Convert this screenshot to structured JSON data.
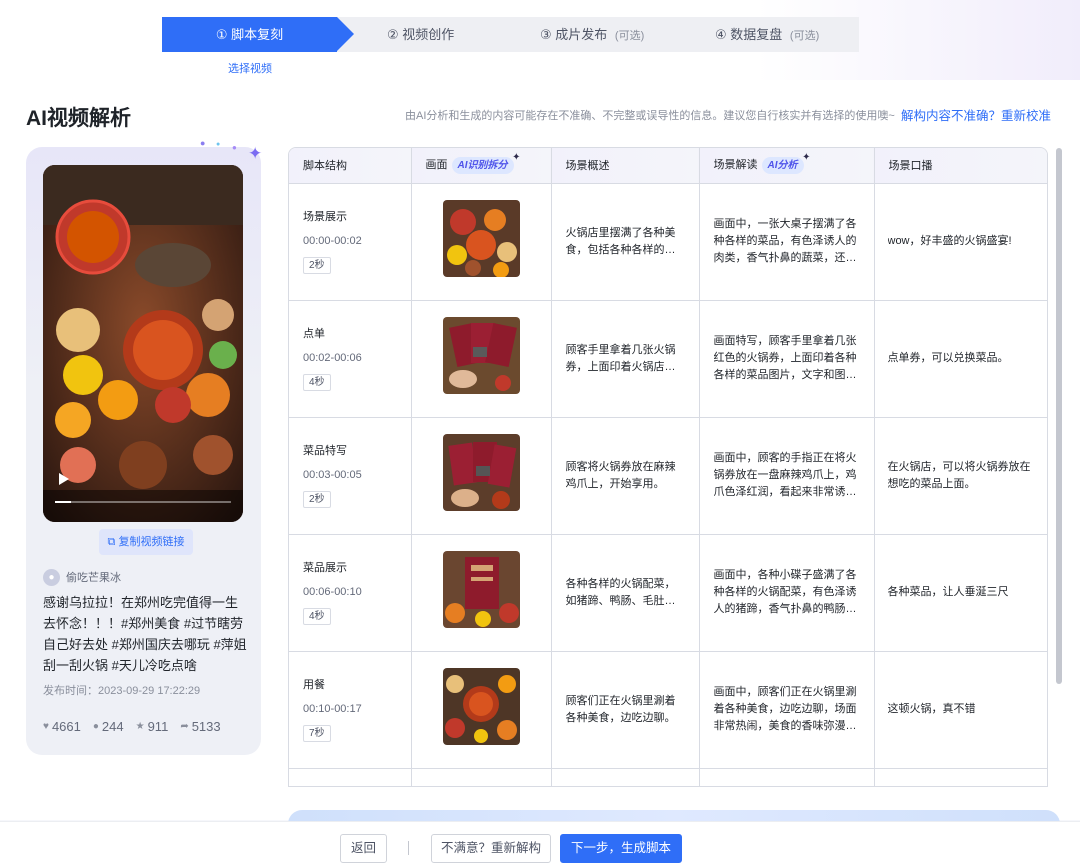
{
  "stepper": {
    "steps": [
      {
        "num": "①",
        "label": "脚本复刻",
        "optional": ""
      },
      {
        "num": "②",
        "label": "视频创作",
        "optional": ""
      },
      {
        "num": "③",
        "label": "成片发布",
        "optional": "(可选)"
      },
      {
        "num": "④",
        "label": "数据复盘",
        "optional": "(可选)"
      }
    ],
    "active_sub": "选择视频"
  },
  "header": {
    "title": "AI视频解析",
    "disclaimer": "由AI分析和生成的内容可能存在不准确、不完整或误导性的信息。建议您自行核实并有选择的使用噢~",
    "recalibrate_link": "解构内容不准确？重新校准"
  },
  "video_card": {
    "copy_link_label": "复制视频链接",
    "author": "偷吃芒果冰",
    "description": "感谢乌拉拉！在郑州吃完值得一生去怀念！！！#郑州美食 #过节瞎劳自己好去处 #郑州国庆去哪玩 #萍姐刮一刮火锅 #天儿冷吃点啥",
    "publish_time": "发布时间：2023-09-29 17:22:29",
    "stats": {
      "likes": "4661",
      "comments": "244",
      "favorites": "911",
      "shares": "5133"
    }
  },
  "table": {
    "headers": {
      "structure": "脚本结构",
      "frame": "画面",
      "frame_tag": "AI识别拆分",
      "summary": "场景概述",
      "interpretation": "场景解读",
      "interpretation_tag": "AI分析",
      "voiceover": "场景口播"
    },
    "rows": [
      {
        "name": "场景展示",
        "time": "00:00-00:02",
        "duration": "2秒",
        "summary": "火锅店里摆满了各种美食，包括各种各样的菜品和火锅。",
        "interpretation": "画面中，一张大桌子摆满了各种各样的菜品，有色泽诱人的肉类，香气扑鼻的蔬菜，还有热气腾腾的火锅。",
        "voiceover": "wow，好丰盛的火锅盛宴!"
      },
      {
        "name": "点单",
        "time": "00:02-00:06",
        "duration": "4秒",
        "summary": "顾客手里拿着几张火锅券，上面印着火锅店的名字和优惠。",
        "interpretation": "画面特写，顾客手里拿着几张红色的火锅券，上面印着各种各样的菜品图片，文字和图案清晰可见。",
        "voiceover": "点单券，可以兑换菜品。"
      },
      {
        "name": "菜品特写",
        "time": "00:03-00:05",
        "duration": "2秒",
        "summary": "顾客将火锅券放在麻辣鸡爪上，开始享用。",
        "interpretation": "画面中，顾客的手指正在将火锅券放在一盘麻辣鸡爪上，鸡爪色泽红润，看起来非常诱人可口。",
        "voiceover": "在火锅店，可以将火锅券放在想吃的菜品上面。"
      },
      {
        "name": "菜品展示",
        "time": "00:06-00:10",
        "duration": "4秒",
        "summary": "各种各样的火锅配菜，如猪蹄、鸭肠、毛肚等等。",
        "interpretation": "画面中，各种小碟子盛满了各种各样的火锅配菜，有色泽诱人的猪蹄，香气扑鼻的鸭肠，还有毛肚。",
        "voiceover": "各种菜品，让人垂涎三尺"
      },
      {
        "name": "用餐",
        "time": "00:10-00:17",
        "duration": "7秒",
        "summary": "顾客们正在火锅里涮着各种美食，边吃边聊。",
        "interpretation": "画面中，顾客们正在火锅里涮着各种美食，边吃边聊，场面非常热闹，美食的香味弥漫在空气中。",
        "voiceover": "这顿火锅，真不错"
      }
    ]
  },
  "footer": {
    "back_label": "返回",
    "redo_label": "不满意？重新解构",
    "next_label": "下一步，生成脚本"
  },
  "colors": {
    "primary": "#2f6ef7",
    "ai_tag_text": "#4f54ea"
  }
}
